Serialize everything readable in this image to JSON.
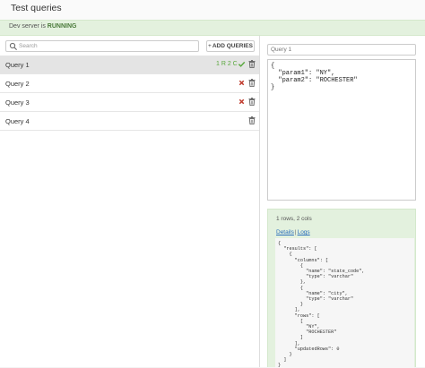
{
  "header": {
    "title": "Test queries"
  },
  "banner": {
    "prefix": "Dev server is ",
    "status": "RUNNING"
  },
  "search": {
    "placeholder": "Search"
  },
  "toolbar": {
    "add_label": "ADD QUERIES"
  },
  "queries": [
    {
      "label": "Query 1",
      "info": "1 R 2 C",
      "status": "success"
    },
    {
      "label": "Query 2",
      "status": "error"
    },
    {
      "label": "Query 3",
      "status": "error"
    },
    {
      "label": "Query 4",
      "status": "none"
    }
  ],
  "editor": {
    "name_placeholder": "Query 1",
    "content": "{\n  \"param1\": \"NY\",\n  \"param2\": \"ROCHESTER\"\n}"
  },
  "result": {
    "summary": "1 rows, 2 cols",
    "details_label": "Details",
    "separator": "|",
    "logs_label": "Logs",
    "json": "{\n  \"results\": [\n    {\n      \"columns\": [\n        {\n          \"name\": \"state_code\",\n          \"type\": \"varchar\"\n        },\n        {\n          \"name\": \"city\",\n          \"type\": \"varchar\"\n        }\n      ],\n      \"rows\": [\n        [\n          \"NY\",\n          \"ROCHESTER\"\n        ]\n      ],\n      \"updatedRows\": 0\n    }\n  ]\n}"
  },
  "colors": {
    "success": "#5aa83e",
    "error": "#c0392b",
    "link": "#2a6ebb",
    "banner_bg": "#e3f1de"
  }
}
